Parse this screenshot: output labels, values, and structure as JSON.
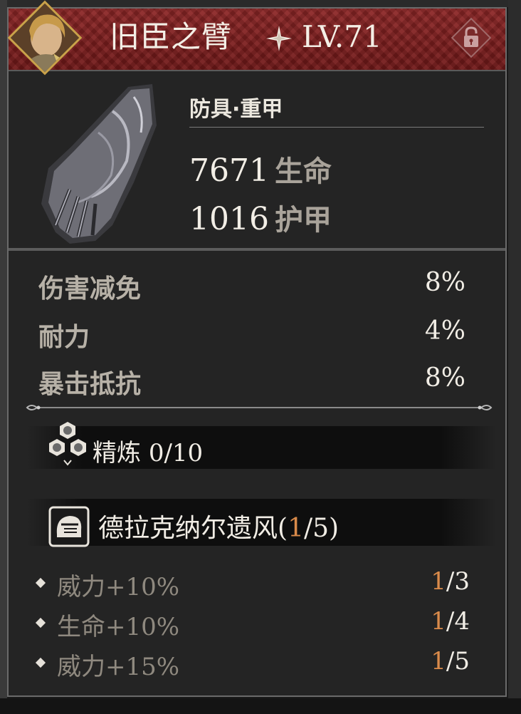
{
  "item": {
    "name": "旧臣之臂",
    "level": "LV.71",
    "category": "防具·重甲",
    "main_stats": [
      {
        "value": "7671",
        "label": "生命"
      },
      {
        "value": "1016",
        "label": "护甲"
      }
    ],
    "sub_stats": [
      {
        "name": "伤害减免",
        "value": "8%"
      },
      {
        "name": "耐力",
        "value": "4%"
      },
      {
        "name": "暴击抵抗",
        "value": "8%"
      }
    ],
    "refine": {
      "label": "精炼",
      "value": "0/10"
    },
    "set": {
      "name": "德拉克纳尔遗风",
      "open": "(",
      "current": "1",
      "total": "/5)",
      "bonuses": [
        {
          "text": "威力+10%",
          "current": "1",
          "total": "/3"
        },
        {
          "text": "生命+10%",
          "current": "1",
          "total": "/4"
        },
        {
          "text": "威力+15%",
          "current": "1",
          "total": "/5"
        }
      ]
    }
  },
  "icons": {
    "portrait": "character-portrait",
    "star": "star-rank-icon",
    "lock": "lock-icon",
    "refine": "hexagon-refine-icon",
    "set": "helmet-set-icon"
  },
  "colors": {
    "header_red": "#7a1c1c",
    "accent_orange": "#d98a4a",
    "text_main": "#f1ede5",
    "text_muted": "#b7b1a7"
  }
}
